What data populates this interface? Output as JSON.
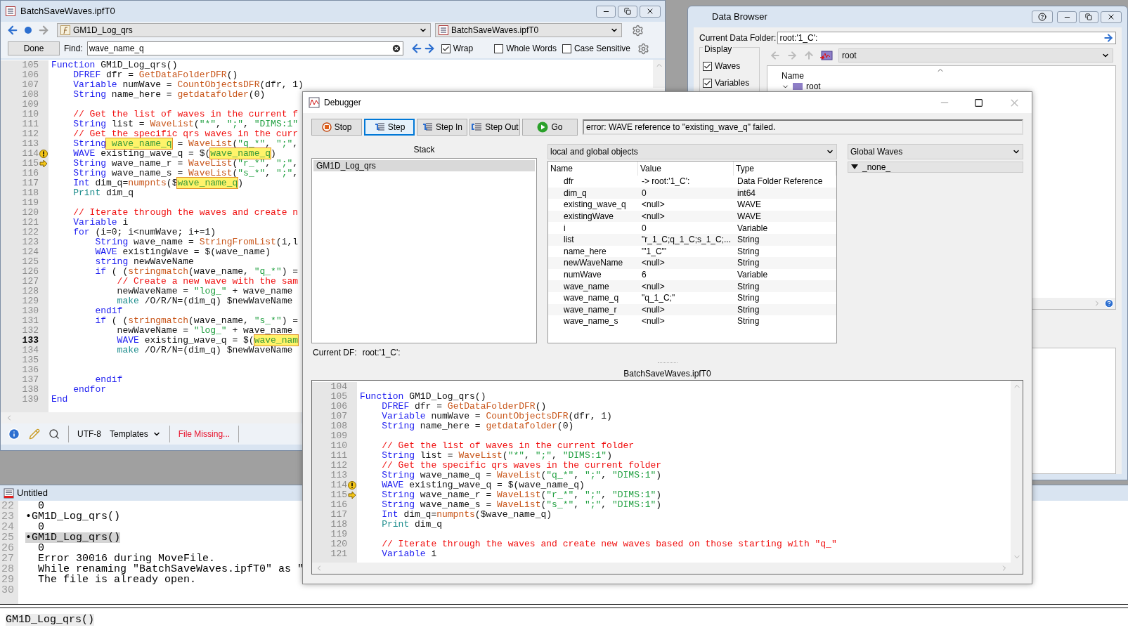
{
  "procedure_window": {
    "title": "BatchSaveWaves.ipfT0",
    "function_menu": "GM1D_Log_qrs",
    "file_menu": "BatchSaveWaves.ipfT0",
    "find": {
      "done": "Done",
      "label": "Find:",
      "value": "wave_name_q",
      "options": [
        {
          "label": "Wrap",
          "checked": true
        },
        {
          "label": "Whole Words",
          "checked": false
        },
        {
          "label": "Case Sensitive",
          "checked": false
        }
      ]
    },
    "lines": [
      {
        "n": "105",
        "current": false,
        "segs": [
          {
            "kind": "kw",
            "text": "Function"
          },
          {
            "kind": "p",
            "text": " GM1D_Log_qrs()"
          }
        ]
      },
      {
        "n": "106",
        "current": false,
        "segs": [
          {
            "kind": "kw",
            "text": "    DFREF"
          },
          {
            "kind": "p",
            "text": " dfr = "
          },
          {
            "kind": "fn",
            "text": "GetDataFolderDFR"
          },
          {
            "kind": "p",
            "text": "()"
          }
        ]
      },
      {
        "n": "107",
        "current": false,
        "segs": [
          {
            "kind": "kw",
            "text": "    Variable"
          },
          {
            "kind": "p",
            "text": " numWave = "
          },
          {
            "kind": "fn",
            "text": "CountObjectsDFR"
          },
          {
            "kind": "p",
            "text": "(dfr, 1)"
          }
        ]
      },
      {
        "n": "108",
        "current": false,
        "segs": [
          {
            "kind": "kw",
            "text": "    String"
          },
          {
            "kind": "p",
            "text": " name_here = "
          },
          {
            "kind": "fn",
            "text": "getdatafolder"
          },
          {
            "kind": "p",
            "text": "(0)"
          }
        ]
      },
      {
        "n": "109",
        "current": false
      },
      {
        "n": "110",
        "current": false,
        "segs": [
          {
            "kind": "cm",
            "text": "    // Get the list of waves in the current f"
          }
        ]
      },
      {
        "n": "111",
        "current": false,
        "segs": [
          {
            "kind": "kw",
            "text": "    String"
          },
          {
            "kind": "p",
            "text": " list = "
          },
          {
            "kind": "fn",
            "text": "WaveList"
          },
          {
            "kind": "p",
            "text": "("
          },
          {
            "kind": "str",
            "text": "\"*\""
          },
          {
            "kind": "p",
            "text": ", "
          },
          {
            "kind": "str",
            "text": "\";\""
          },
          {
            "kind": "p",
            "text": ", "
          },
          {
            "kind": "str",
            "text": "\"DIMS:1\""
          }
        ]
      },
      {
        "n": "112",
        "current": false,
        "segs": [
          {
            "kind": "cm",
            "text": "    // Get the specific qrs waves in the curr"
          }
        ]
      },
      {
        "n": "113",
        "current": false,
        "segs": [
          {
            "kind": "kw",
            "text": "    String"
          },
          {
            "kind": "hl",
            "text": "wave_name_q"
          },
          {
            "kind": "p",
            "text": " = "
          },
          {
            "kind": "fn",
            "text": "WaveList"
          },
          {
            "kind": "p",
            "text": "("
          },
          {
            "kind": "str",
            "text": "\"q_*\""
          },
          {
            "kind": "p",
            "text": ", "
          },
          {
            "kind": "str",
            "text": "\";\""
          },
          {
            "kind": "p",
            "text": ","
          }
        ]
      },
      {
        "n": "114",
        "current": false,
        "kind": "warning",
        "segs": [
          {
            "kind": "kw",
            "text": "    WAVE"
          },
          {
            "kind": "p",
            "text": " existing_wave_q = $("
          },
          {
            "kind": "hl",
            "text": "wave_name_q"
          },
          {
            "kind": "p",
            "text": ")"
          }
        ]
      },
      {
        "n": "115",
        "current": false,
        "kind": "arrow",
        "segs": [
          {
            "kind": "kw",
            "text": "    String"
          },
          {
            "kind": "p",
            "text": " wave_name_r = "
          },
          {
            "kind": "fn",
            "text": "WaveList"
          },
          {
            "kind": "p",
            "text": "("
          },
          {
            "kind": "str",
            "text": "\"r_*\""
          },
          {
            "kind": "p",
            "text": ", "
          },
          {
            "kind": "str",
            "text": "\";\""
          },
          {
            "kind": "p",
            "text": ","
          }
        ]
      },
      {
        "n": "116",
        "current": false,
        "segs": [
          {
            "kind": "kw",
            "text": "    String"
          },
          {
            "kind": "p",
            "text": " wave_name_s = "
          },
          {
            "kind": "fn",
            "text": "WaveList"
          },
          {
            "kind": "p",
            "text": "("
          },
          {
            "kind": "str",
            "text": "\"s_*\""
          },
          {
            "kind": "p",
            "text": ", "
          },
          {
            "kind": "str",
            "text": "\";\""
          },
          {
            "kind": "p",
            "text": ","
          }
        ]
      },
      {
        "n": "117",
        "current": false,
        "segs": [
          {
            "kind": "kw",
            "text": "    Int"
          },
          {
            "kind": "p",
            "text": " dim_q="
          },
          {
            "kind": "fn",
            "text": "numpnts"
          },
          {
            "kind": "p",
            "text": "($"
          },
          {
            "kind": "hl",
            "text": "wave_name_q"
          },
          {
            "kind": "p",
            "text": ")"
          }
        ]
      },
      {
        "n": "118",
        "current": false,
        "segs": [
          {
            "kind": "op",
            "text": "    Print"
          },
          {
            "kind": "p",
            "text": " dim_q"
          }
        ]
      },
      {
        "n": "119",
        "current": false
      },
      {
        "n": "120",
        "current": false,
        "segs": [
          {
            "kind": "cm",
            "text": "    // Iterate through the waves and create n"
          }
        ]
      },
      {
        "n": "121",
        "current": false,
        "segs": [
          {
            "kind": "kw",
            "text": "    Variable"
          },
          {
            "kind": "p",
            "text": " i"
          }
        ]
      },
      {
        "n": "122",
        "current": false,
        "segs": [
          {
            "kind": "kw",
            "text": "    for"
          },
          {
            "kind": "p",
            "text": " (i=0; i<numWave; i+=1)"
          }
        ]
      },
      {
        "n": "123",
        "current": false,
        "segs": [
          {
            "kind": "kw",
            "text": "        String"
          },
          {
            "kind": "p",
            "text": " wave_name = "
          },
          {
            "kind": "fn",
            "text": "StringFromList"
          },
          {
            "kind": "p",
            "text": "(i,l"
          }
        ]
      },
      {
        "n": "124",
        "current": false,
        "segs": [
          {
            "kind": "kw",
            "text": "        WAVE"
          },
          {
            "kind": "p",
            "text": " existingWave = $(wave_name)"
          }
        ]
      },
      {
        "n": "125",
        "current": false,
        "segs": [
          {
            "kind": "kw",
            "text": "        string"
          },
          {
            "kind": "p",
            "text": " newWaveName"
          }
        ]
      },
      {
        "n": "126",
        "current": false,
        "segs": [
          {
            "kind": "kw",
            "text": "        if"
          },
          {
            "kind": "p",
            "text": " ( ("
          },
          {
            "kind": "fn",
            "text": "stringmatch"
          },
          {
            "kind": "p",
            "text": "(wave_name, "
          },
          {
            "kind": "str",
            "text": "\"q_*\""
          },
          {
            "kind": "p",
            "text": ") ="
          }
        ]
      },
      {
        "n": "127",
        "current": false,
        "segs": [
          {
            "kind": "cm",
            "text": "            // Create a new wave with the sam"
          }
        ]
      },
      {
        "n": "128",
        "current": false,
        "segs": [
          {
            "kind": "p",
            "text": "            newWaveName = "
          },
          {
            "kind": "str",
            "text": "\"log_\""
          },
          {
            "kind": "p",
            "text": " + wave_name"
          }
        ]
      },
      {
        "n": "129",
        "current": false,
        "segs": [
          {
            "kind": "op",
            "text": "            make"
          },
          {
            "kind": "p",
            "text": " /O/R/N=(dim_q) $newWaveName"
          }
        ]
      },
      {
        "n": "130",
        "current": false,
        "segs": [
          {
            "kind": "kw",
            "text": "        endif"
          }
        ]
      },
      {
        "n": "131",
        "current": false,
        "segs": [
          {
            "kind": "kw",
            "text": "        if"
          },
          {
            "kind": "p",
            "text": " ( ("
          },
          {
            "kind": "fn",
            "text": "stringmatch"
          },
          {
            "kind": "p",
            "text": "(wave_name, "
          },
          {
            "kind": "str",
            "text": "\"s_*\""
          },
          {
            "kind": "p",
            "text": ") ="
          }
        ]
      },
      {
        "n": "132",
        "current": false,
        "segs": [
          {
            "kind": "p",
            "text": "            newWaveName = "
          },
          {
            "kind": "str",
            "text": "\"log_\""
          },
          {
            "kind": "p",
            "text": " + wave_name"
          }
        ]
      },
      {
        "n": "133",
        "current": true,
        "segs": [
          {
            "kind": "kw",
            "text": "            WAVE"
          },
          {
            "kind": "p",
            "text": " existing_wave_q = $("
          },
          {
            "kind": "hl",
            "text": "wave_nam"
          }
        ]
      },
      {
        "n": "134",
        "current": false,
        "segs": [
          {
            "kind": "op",
            "text": "            make"
          },
          {
            "kind": "p",
            "text": " /O/R/N=(dim_q) $newWaveName"
          }
        ]
      },
      {
        "n": "135",
        "current": false
      },
      {
        "n": "136",
        "current": false
      },
      {
        "n": "137",
        "current": false,
        "segs": [
          {
            "kind": "kw",
            "text": "        endif"
          }
        ]
      },
      {
        "n": "138",
        "current": false,
        "segs": [
          {
            "kind": "kw",
            "text": "    endfor"
          }
        ]
      },
      {
        "n": "139",
        "current": false,
        "segs": [
          {
            "kind": "kw",
            "text": "End"
          }
        ]
      }
    ],
    "status_bar": {
      "encoding": "UTF-8",
      "templates": "Templates",
      "file_status": "File Missing..."
    }
  },
  "data_browser": {
    "title": "Data Browser",
    "folder_label": "Current Data Folder:",
    "folder_value": "root:'1_C':",
    "display": {
      "label": "Display",
      "options": [
        {
          "label": "Waves",
          "checked": true
        },
        {
          "label": "Variables",
          "checked": true
        }
      ]
    },
    "folder_menu": "root",
    "tree_header": "Name",
    "tree": [
      {
        "label": "root",
        "expanded": true
      }
    ]
  },
  "command_window": {
    "title": "Untitled",
    "lines": [
      {
        "n": "22",
        "text": "0",
        "selected": false
      },
      {
        "n": "23",
        "bullet": "•",
        "text": "GM1D_Log_qrs()",
        "selected": false
      },
      {
        "n": "24",
        "text": "0",
        "selected": false
      },
      {
        "n": "25",
        "bullet": "•",
        "text": "GM1D_Log_qrs()",
        "selected": true
      },
      {
        "n": "26",
        "text": "0",
        "selected": false
      },
      {
        "n": "27",
        "text": "Error 30016 during MoveFile.",
        "selected": false
      },
      {
        "n": "28",
        "text": "While renaming \"BatchSaveWaves.ipfT0\" as \"",
        "selected": false
      },
      {
        "n": "29",
        "text": "The file is already open.",
        "selected": false
      },
      {
        "n": "30"
      }
    ],
    "command_line": "GM1D_Log_qrs()"
  },
  "debugger": {
    "title": "Debugger",
    "buttons": [
      {
        "label": "Stop",
        "kind": "stop",
        "selected": false
      },
      {
        "label": "Step",
        "kind": "step",
        "selected": true
      },
      {
        "label": "Step In",
        "kind": "stepin",
        "selected": false
      },
      {
        "label": "Step Out",
        "kind": "stepout",
        "selected": false
      },
      {
        "label": "Go",
        "kind": "go",
        "selected": false
      }
    ],
    "message": "error: WAVE reference to \"existing_wave_q\" failed.",
    "stack_label": "Stack",
    "stack": [
      {
        "label": "GM1D_Log_qrs",
        "selected": true
      }
    ],
    "objects_menu": "local and global objects",
    "columns": [
      "Name",
      "Value",
      "Type"
    ],
    "variables": [
      {
        "name": "dfr",
        "value": "-> root:'1_C':",
        "type": "Data Folder Reference"
      },
      {
        "name": "dim_q",
        "value": "0",
        "type": "int64"
      },
      {
        "name": "existing_wave_q",
        "value": "<null>",
        "type": "WAVE"
      },
      {
        "name": "existingWave",
        "value": "<null>",
        "type": "WAVE"
      },
      {
        "name": "i",
        "value": "0",
        "type": "Variable"
      },
      {
        "name": "list",
        "value": "\"r_1_C;q_1_C;s_1_C;...",
        "type": "String"
      },
      {
        "name": "name_here",
        "value": "\"'1_C'\"",
        "type": "String"
      },
      {
        "name": "newWaveName",
        "value": "<null>",
        "type": "String"
      },
      {
        "name": "numWave",
        "value": "6",
        "type": "Variable"
      },
      {
        "name": "wave_name",
        "value": "<null>",
        "type": "String"
      },
      {
        "name": "wave_name_q",
        "value": "\"q_1_C;\"",
        "type": "String"
      },
      {
        "name": "wave_name_r",
        "value": "<null>",
        "type": "String"
      },
      {
        "name": "wave_name_s",
        "value": "<null>",
        "type": "String"
      }
    ],
    "waves_menu": "Global Waves",
    "waves_tree": [
      {
        "label": "_none_",
        "expanded": true
      }
    ],
    "current_df_label": "Current DF:",
    "current_df": "root:'1_C':",
    "file_label": "BatchSaveWaves.ipfT0",
    "lines": [
      {
        "n": "104"
      },
      {
        "n": "105",
        "segs": [
          {
            "kind": "kw",
            "text": "Function"
          },
          {
            "kind": "p",
            "text": " GM1D_Log_qrs()"
          }
        ]
      },
      {
        "n": "106",
        "segs": [
          {
            "kind": "kw",
            "text": "    DFREF"
          },
          {
            "kind": "p",
            "text": " dfr = "
          },
          {
            "kind": "fn",
            "text": "GetDataFolderDFR"
          },
          {
            "kind": "p",
            "text": "()"
          }
        ]
      },
      {
        "n": "107",
        "segs": [
          {
            "kind": "kw",
            "text": "    Variable"
          },
          {
            "kind": "p",
            "text": " numWave = "
          },
          {
            "kind": "fn",
            "text": "CountObjectsDFR"
          },
          {
            "kind": "p",
            "text": "(dfr, 1)"
          }
        ]
      },
      {
        "n": "108",
        "segs": [
          {
            "kind": "kw",
            "text": "    String"
          },
          {
            "kind": "p",
            "text": " name_here = "
          },
          {
            "kind": "fn",
            "text": "getdatafolder"
          },
          {
            "kind": "p",
            "text": "(0)"
          }
        ]
      },
      {
        "n": "109"
      },
      {
        "n": "110",
        "segs": [
          {
            "kind": "cm",
            "text": "    // Get the list of waves in the current folder"
          }
        ]
      },
      {
        "n": "111",
        "segs": [
          {
            "kind": "kw",
            "text": "    String"
          },
          {
            "kind": "p",
            "text": " list = "
          },
          {
            "kind": "fn",
            "text": "WaveList"
          },
          {
            "kind": "p",
            "text": "("
          },
          {
            "kind": "str",
            "text": "\"*\""
          },
          {
            "kind": "p",
            "text": ", "
          },
          {
            "kind": "str",
            "text": "\";\""
          },
          {
            "kind": "p",
            "text": ", "
          },
          {
            "kind": "str",
            "text": "\"DIMS:1\""
          },
          {
            "kind": "p",
            "text": ")"
          }
        ]
      },
      {
        "n": "112",
        "segs": [
          {
            "kind": "cm",
            "text": "    // Get the specific qrs waves in the current folder"
          }
        ]
      },
      {
        "n": "113",
        "segs": [
          {
            "kind": "kw",
            "text": "    String"
          },
          {
            "kind": "p",
            "text": " wave_name_q = "
          },
          {
            "kind": "fn",
            "text": "WaveList"
          },
          {
            "kind": "p",
            "text": "("
          },
          {
            "kind": "str",
            "text": "\"q_*\""
          },
          {
            "kind": "p",
            "text": ", "
          },
          {
            "kind": "str",
            "text": "\";\""
          },
          {
            "kind": "p",
            "text": ", "
          },
          {
            "kind": "str",
            "text": "\"DIMS:1\""
          },
          {
            "kind": "p",
            "text": ")"
          }
        ]
      },
      {
        "n": "114",
        "kind": "warning",
        "segs": [
          {
            "kind": "kw",
            "text": "    WAVE"
          },
          {
            "kind": "p",
            "text": " existing_wave_q = $(wave_name_q)"
          }
        ]
      },
      {
        "n": "115",
        "kind": "arrow",
        "segs": [
          {
            "kind": "kw",
            "text": "    String"
          },
          {
            "kind": "p",
            "text": " wave_name_r = "
          },
          {
            "kind": "fn",
            "text": "WaveList"
          },
          {
            "kind": "p",
            "text": "("
          },
          {
            "kind": "str",
            "text": "\"r_*\""
          },
          {
            "kind": "p",
            "text": ", "
          },
          {
            "kind": "str",
            "text": "\";\""
          },
          {
            "kind": "p",
            "text": ", "
          },
          {
            "kind": "str",
            "text": "\"DIMS:1\""
          },
          {
            "kind": "p",
            "text": ")"
          }
        ]
      },
      {
        "n": "116",
        "segs": [
          {
            "kind": "kw",
            "text": "    String"
          },
          {
            "kind": "p",
            "text": " wave_name_s = "
          },
          {
            "kind": "fn",
            "text": "WaveList"
          },
          {
            "kind": "p",
            "text": "("
          },
          {
            "kind": "str",
            "text": "\"s_*\""
          },
          {
            "kind": "p",
            "text": ", "
          },
          {
            "kind": "str",
            "text": "\";\""
          },
          {
            "kind": "p",
            "text": ", "
          },
          {
            "kind": "str",
            "text": "\"DIMS:1\""
          },
          {
            "kind": "p",
            "text": ")"
          }
        ]
      },
      {
        "n": "117",
        "segs": [
          {
            "kind": "kw",
            "text": "    Int"
          },
          {
            "kind": "p",
            "text": " dim_q="
          },
          {
            "kind": "fn",
            "text": "numpnts"
          },
          {
            "kind": "p",
            "text": "($wave_name_q)"
          }
        ]
      },
      {
        "n": "118",
        "segs": [
          {
            "kind": "op",
            "text": "    Print"
          },
          {
            "kind": "p",
            "text": " dim_q"
          }
        ]
      },
      {
        "n": "119"
      },
      {
        "n": "120",
        "segs": [
          {
            "kind": "cm",
            "text": "    // Iterate through the waves and create new waves based on those starting with \"q_\""
          }
        ]
      },
      {
        "n": "121",
        "segs": [
          {
            "kind": "kw",
            "text": "    Variable"
          },
          {
            "kind": "p",
            "text": " i"
          }
        ]
      }
    ]
  }
}
